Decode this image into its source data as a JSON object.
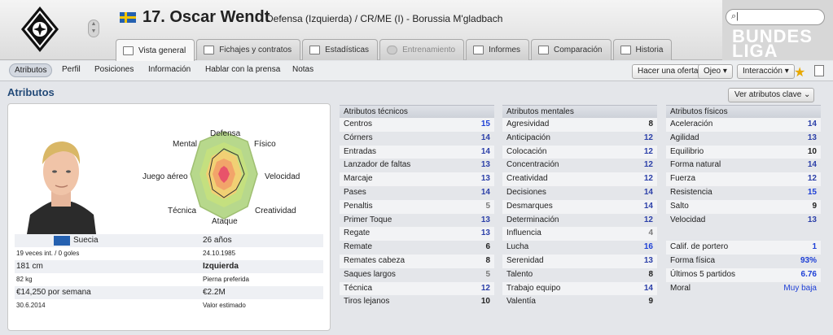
{
  "header": {
    "number_name": "17. Oscar Wendt",
    "description": "Defensa (Izquierda) / CR/ME (I) - Borussia M'gladbach",
    "league_logo": "BUNDES LIGA",
    "search_placeholder": ""
  },
  "tabs": [
    {
      "label": "Vista general",
      "icon": "profile-icon"
    },
    {
      "label": "Fichajes y contratos",
      "icon": "contract-icon"
    },
    {
      "label": "Estadísticas",
      "icon": "stats-icon"
    },
    {
      "label": "Entrenamiento",
      "icon": "cloud-icon"
    },
    {
      "label": "Informes",
      "icon": "report-icon"
    },
    {
      "label": "Comparación",
      "icon": "compare-icon"
    },
    {
      "label": "Historia",
      "icon": "history-icon"
    }
  ],
  "subnav": {
    "items": [
      "Atributos",
      "Perfil",
      "Posiciones",
      "Información",
      "Hablar con la prensa",
      "Notas"
    ],
    "offer_button": "Hacer una oferta",
    "scout_button": "Ojeo",
    "interaction_button": "Interacción"
  },
  "section": {
    "title": "Atributos",
    "view_button": "Ver atributos clave"
  },
  "radar": {
    "labels": {
      "top": "Defensa",
      "top_right": "Físico",
      "right": "Velocidad",
      "bottom_right": "Creatividad",
      "bottom": "Ataque",
      "bottom_left": "Técnica",
      "left": "Juego aéreo",
      "top_left": "Mental"
    }
  },
  "player_info": {
    "nationality": "Suecia",
    "caps": "19 veces int. / 0 goles",
    "age": "26 años",
    "birthdate": "24.10.1985",
    "height": "181 cm",
    "foot": "Izquierda",
    "weight": "82 kg",
    "foot_label": "Pierna preferida",
    "wage": "€14,250 por semana",
    "value": "€2.2M",
    "contract_end": "30.6.2014",
    "value_label": "Valor estimado"
  },
  "technical": {
    "header": "Atributos técnicos",
    "rows": [
      {
        "name": "Centros",
        "value": "15"
      },
      {
        "name": "Córners",
        "value": "14"
      },
      {
        "name": "Entradas",
        "value": "14"
      },
      {
        "name": "Lanzador de faltas",
        "value": "13"
      },
      {
        "name": "Marcaje",
        "value": "13"
      },
      {
        "name": "Pases",
        "value": "14"
      },
      {
        "name": "Penaltis",
        "value": "5"
      },
      {
        "name": "Primer Toque",
        "value": "13"
      },
      {
        "name": "Regate",
        "value": "13"
      },
      {
        "name": "Remate",
        "value": "6"
      },
      {
        "name": "Remates cabeza",
        "value": "8"
      },
      {
        "name": "Saques largos",
        "value": "5"
      },
      {
        "name": "Técnica",
        "value": "12"
      },
      {
        "name": "Tiros lejanos",
        "value": "10"
      }
    ]
  },
  "mental": {
    "header": "Atributos mentales",
    "rows": [
      {
        "name": "Agresividad",
        "value": "8"
      },
      {
        "name": "Anticipación",
        "value": "12"
      },
      {
        "name": "Colocación",
        "value": "12"
      },
      {
        "name": "Concentración",
        "value": "12"
      },
      {
        "name": "Creatividad",
        "value": "12"
      },
      {
        "name": "Decisiones",
        "value": "14"
      },
      {
        "name": "Desmarques",
        "value": "14"
      },
      {
        "name": "Determinación",
        "value": "12"
      },
      {
        "name": "Influencia",
        "value": "4"
      },
      {
        "name": "Lucha",
        "value": "16"
      },
      {
        "name": "Serenidad",
        "value": "13"
      },
      {
        "name": "Talento",
        "value": "8"
      },
      {
        "name": "Trabajo equipo",
        "value": "14"
      },
      {
        "name": "Valentía",
        "value": "9"
      }
    ]
  },
  "physical": {
    "header": "Atributos físicos",
    "rows": [
      {
        "name": "Aceleración",
        "value": "14"
      },
      {
        "name": "Agilidad",
        "value": "13"
      },
      {
        "name": "Equilibrio",
        "value": "10"
      },
      {
        "name": "Forma natural",
        "value": "14"
      },
      {
        "name": "Fuerza",
        "value": "12"
      },
      {
        "name": "Resistencia",
        "value": "15"
      },
      {
        "name": "Salto",
        "value": "9"
      },
      {
        "name": "Velocidad",
        "value": "13"
      }
    ],
    "extra": [
      {
        "name": "Calif. de portero",
        "value": "1"
      },
      {
        "name": "Forma física",
        "value": "93%"
      },
      {
        "name": "Últimos 5 partidos",
        "value": "6.76"
      },
      {
        "name": "Moral",
        "value": "Muy baja"
      }
    ]
  },
  "colors": {
    "low": "#7a7a7a",
    "mid": "#222222",
    "good": "#2b3fa8",
    "high": "#1d3fd6",
    "title": "#234a78"
  }
}
